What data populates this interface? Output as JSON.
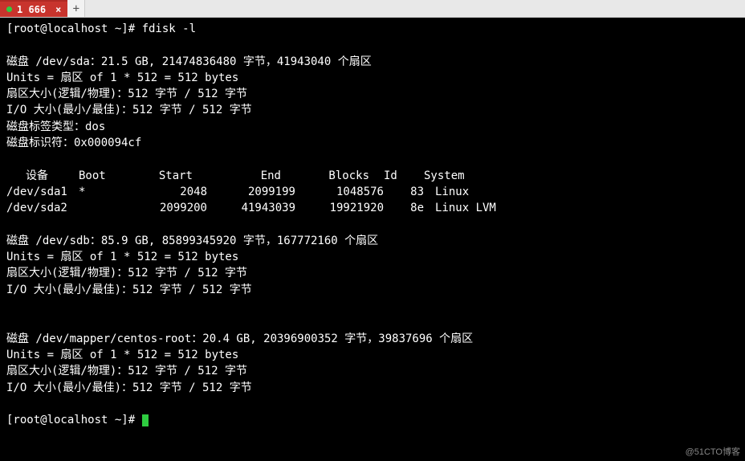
{
  "tabbar": {
    "active_tab_label": "1 666",
    "close_glyph": "×",
    "newtab_glyph": "+"
  },
  "prompt": {
    "p1": "[root@localhost ~]# ",
    "cmd": "fdisk -l",
    "p2": "[root@localhost ~]# "
  },
  "disk_sda": {
    "header": "磁盘 /dev/sda：21.5 GB, 21474836480 字节，41943040 个扇区",
    "units": "Units = 扇区 of 1 * 512 = 512 bytes",
    "sector": "扇区大小(逻辑/物理)：512 字节 / 512 字节",
    "io": "I/O 大小(最小/最佳)：512 字节 / 512 字节",
    "labeltype": "磁盘标签类型：dos",
    "identifier": "磁盘标识符：0x000094cf"
  },
  "part_header": {
    "device": "设备",
    "boot": "Boot",
    "start": "Start",
    "end": "End",
    "blocks": "Blocks",
    "id": "Id",
    "system": "System"
  },
  "partitions": [
    {
      "device": "/dev/sda1",
      "boot": "*",
      "start": "2048",
      "end": "2099199",
      "blocks": "1048576",
      "id": "83",
      "system": "Linux"
    },
    {
      "device": "/dev/sda2",
      "boot": "",
      "start": "2099200",
      "end": "41943039",
      "blocks": "19921920",
      "id": "8e",
      "system": "Linux LVM"
    }
  ],
  "disk_sdb": {
    "header": "磁盘 /dev/sdb：85.9 GB, 85899345920 字节，167772160 个扇区",
    "units": "Units = 扇区 of 1 * 512 = 512 bytes",
    "sector": "扇区大小(逻辑/物理)：512 字节 / 512 字节",
    "io": "I/O 大小(最小/最佳)：512 字节 / 512 字节"
  },
  "disk_mapper": {
    "header": "磁盘 /dev/mapper/centos-root：20.4 GB, 20396900352 字节，39837696 个扇区",
    "units": "Units = 扇区 of 1 * 512 = 512 bytes",
    "sector": "扇区大小(逻辑/物理)：512 字节 / 512 字节",
    "io": "I/O 大小(最小/最佳)：512 字节 / 512 字节"
  },
  "watermark": "@51CTO博客"
}
